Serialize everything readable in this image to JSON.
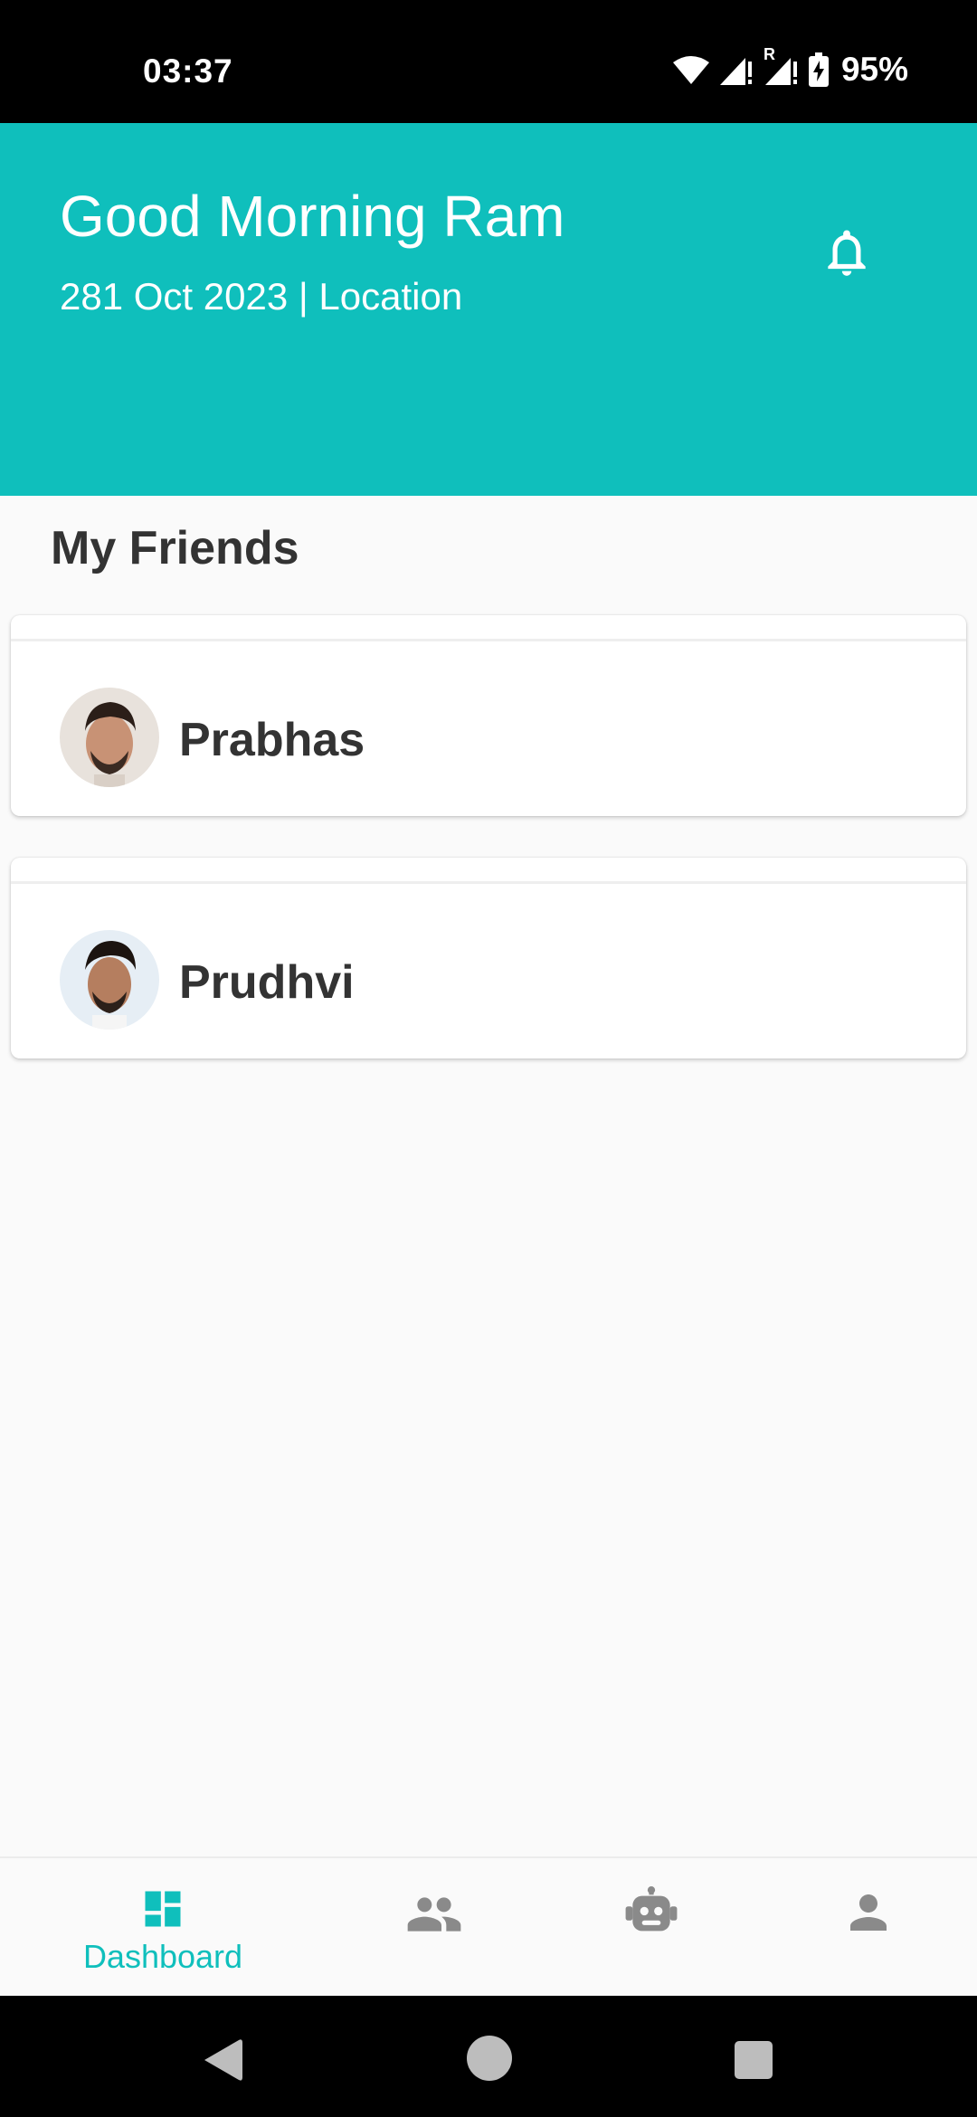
{
  "status_bar": {
    "time": "03:37",
    "battery": "95%",
    "roaming_mark": "R",
    "icons": [
      "wifi-icon",
      "signal-icon",
      "signal-roaming-icon",
      "battery-charging-icon"
    ]
  },
  "header": {
    "greeting": "Good Morning Ram",
    "subtitle": "281 Oct 2023 | Location",
    "bell_icon": "bell-icon",
    "background_color": "#0fbfbc"
  },
  "friends": {
    "title": "My Friends",
    "items": [
      {
        "name": "Prabhas",
        "avatar": "avatar-prabhas"
      },
      {
        "name": "Prudhvi",
        "avatar": "avatar-prudhvi"
      }
    ]
  },
  "bottom_nav": {
    "items": [
      {
        "label": "Dashboard",
        "icon": "dashboard-icon",
        "active": true
      },
      {
        "label": "",
        "icon": "people-icon",
        "active": false
      },
      {
        "label": "",
        "icon": "robot-icon",
        "active": false
      },
      {
        "label": "",
        "icon": "person-icon",
        "active": false
      }
    ],
    "active_color": "#0fbfbc",
    "inactive_color": "#8a8a8a"
  },
  "system_nav": {
    "icons": [
      "back-icon",
      "home-icon",
      "recents-icon"
    ]
  }
}
